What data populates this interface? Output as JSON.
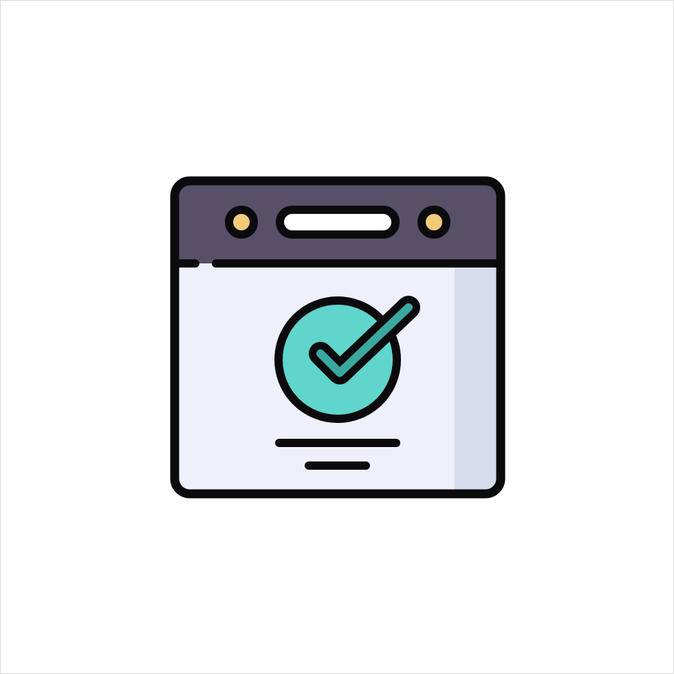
{
  "icon": {
    "name": "browser-window-checkmark-icon",
    "colors": {
      "outline": "#0b0b0d",
      "title_bar": "#585068",
      "window_body": "#eef0fb",
      "window_shade": "#d7dcec",
      "indicator_dot": "#f2cb7a",
      "address_bar": "#ffffff",
      "check_circle": "#5fd5cc",
      "check_mark": "#3aa89f",
      "background": "#ffffff"
    }
  }
}
